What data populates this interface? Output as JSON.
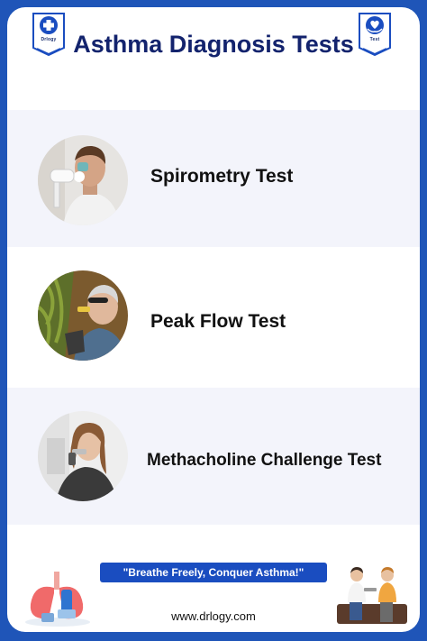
{
  "header": {
    "title": "Asthma Diagnosis Tests",
    "left_badge": {
      "label": "Drlogy",
      "icon": "medical-cross-icon"
    },
    "right_badge": {
      "label": "Test",
      "icon": "hand-heart-icon"
    }
  },
  "tests": [
    {
      "label": "Spirometry Test",
      "image": "man-using-spirometer-photo"
    },
    {
      "label": "Peak Flow Test",
      "image": "elderly-man-using-peak-flow-meter-photo"
    },
    {
      "label": "Methacholine Challenge Test",
      "image": "woman-using-inhaler-device-photo"
    }
  ],
  "footer": {
    "slogan": "\"Breathe Freely, Conquer Asthma!\"",
    "website": "www.drlogy.com",
    "left_illustration": "lungs-with-inhaler-illustration",
    "right_illustration": "doctor-consulting-patient-illustration"
  },
  "colors": {
    "border": "#1f55b8",
    "title": "#13236d",
    "row_shaded": "#f3f4fb",
    "slogan_bg": "#1a4dc0"
  }
}
